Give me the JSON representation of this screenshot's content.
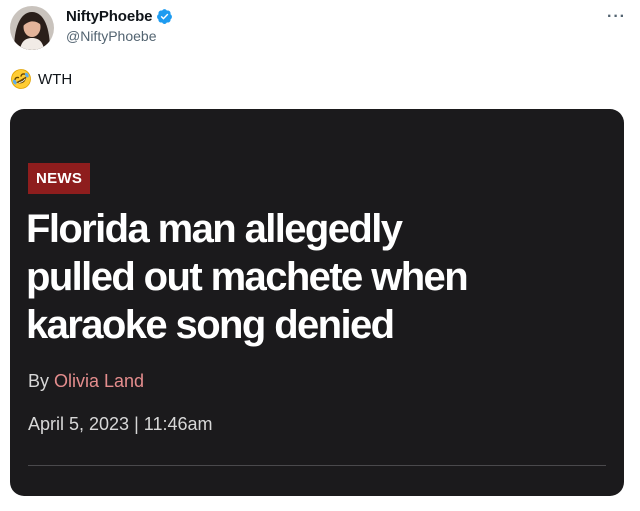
{
  "tweet": {
    "author": {
      "display_name": "NiftyPhoebe",
      "handle": "@NiftyPhoebe",
      "verified": true
    },
    "more_label": "···",
    "emoji_icon": "rolling-on-floor-laughing-emoji",
    "text": "WTH"
  },
  "article_card": {
    "badge": "NEWS",
    "headline_lines": [
      "Florida man allegedly",
      "pulled out machete when",
      "karaoke song denied"
    ],
    "byline_prefix": "By ",
    "author": "Olivia Land",
    "date": "April 5, 2023",
    "separator": " | ",
    "time": "11:46am"
  },
  "colors": {
    "verified_blue": "#1d9bf0",
    "card_background": "#1b1a1c",
    "badge_red": "#8e1d1d",
    "author_link": "#e48d8d"
  }
}
